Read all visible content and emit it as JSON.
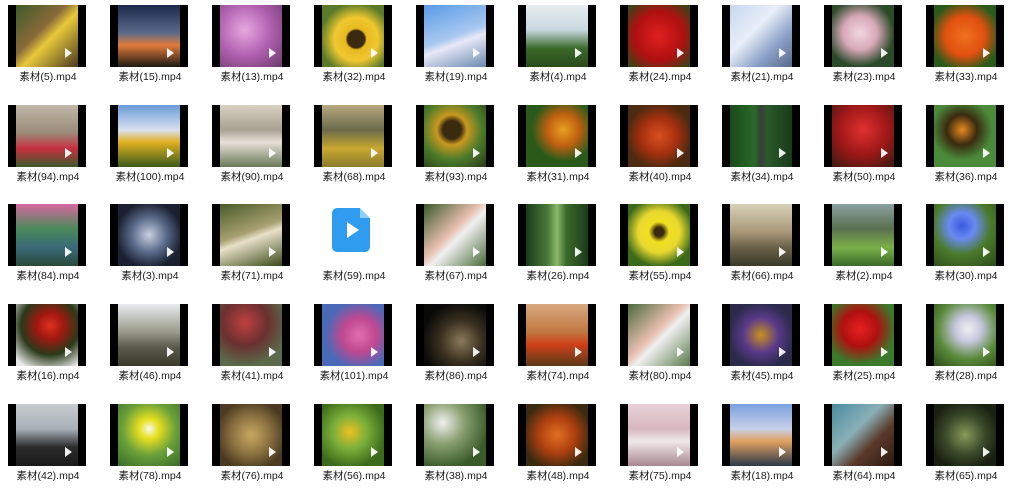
{
  "files": [
    {
      "name": "素材(5).mp4",
      "bg": "linear-gradient(135deg,#3d5a2a,#8a6a3a 40%,#e8c83a 55%,#4a3a20)"
    },
    {
      "name": "素材(15).mp4",
      "bg": "linear-gradient(180deg,#1b2a4a,#5b6a8a 45%,#e07a3a 65%,#1a1a14)"
    },
    {
      "name": "素材(13).mp4",
      "bg": "radial-gradient(circle at 40% 40%,#e8a8e0,#b060b0 50%,#6a3a6a)"
    },
    {
      "name": "素材(32).mp4",
      "bg": "radial-gradient(circle at 55% 55%,#3a2a10 18%,#e8b820 22%,#f0c830 45%,#5a7a2a 75%)"
    },
    {
      "name": "素材(19).mp4",
      "bg": "linear-gradient(160deg,#5a9ae8,#a8c8f0 50%,#e8e8f8 60%,#6a8ab0)"
    },
    {
      "name": "素材(4).mp4",
      "bg": "linear-gradient(180deg,#e8eef0,#c8d8e0 40%,#3a6a2a 70%,#2a4a1a)"
    },
    {
      "name": "素材(24).mp4",
      "bg": "radial-gradient(circle at 50% 50%,#e02020,#b01010 55%,#2a4a1a)"
    },
    {
      "name": "素材(21).mp4",
      "bg": "linear-gradient(135deg,#c8d8f0,#e8eef8 40%,#8aa0c8 70%,#5a6a8a)"
    },
    {
      "name": "素材(23).mp4",
      "bg": "radial-gradient(circle at 45% 45%,#f0d8e0,#d8a8b8 35%,#2a4a2a 70%)"
    },
    {
      "name": "素材(33).mp4",
      "bg": "radial-gradient(circle at 50% 50%,#f07020,#e05010 45%,#2a5a1a 80%)"
    },
    {
      "name": "素材(94).mp4",
      "bg": "linear-gradient(180deg,#c0b8a8,#9a8a78 45%,#c83040 70%,#3a5a2a)"
    },
    {
      "name": "素材(100).mp4",
      "bg": "linear-gradient(180deg,#6a9ad8,#d8e0f0 40%,#e0b020 60%,#3a5a1a)"
    },
    {
      "name": "素材(90).mp4",
      "bg": "linear-gradient(180deg,#d8d0c0,#a8a090 40%,#e8e0d8 60%,#6a7a5a)"
    },
    {
      "name": "素材(68).mp4",
      "bg": "linear-gradient(180deg,#b8a880,#6a6a4a 40%,#c8a830 70%,#8a7a2a)"
    },
    {
      "name": "素材(93).mp4",
      "bg": "radial-gradient(circle at 45% 40%,#3a2a10 18%,#c89820 30%,#4a7a2a 60%,#2a3a1a)"
    },
    {
      "name": "素材(31).mp4",
      "bg": "radial-gradient(circle at 60% 40%,#e8a020,#c06010 30%,#2a5a1a 60%)"
    },
    {
      "name": "素材(40).mp4",
      "bg": "radial-gradient(circle at 50% 50%,#d85020,#a83010 40%,#4a2a10 75%)"
    },
    {
      "name": "素材(34).mp4",
      "bg": "linear-gradient(90deg,#1a4a1a,#2a6a2a 40%,#3a3a3a 50%,#2a5a2a 60%,#1a3a1a)"
    },
    {
      "name": "素材(50).mp4",
      "bg": "radial-gradient(circle at 50% 40%,#e03030,#a01818 50%,#3a1a10)"
    },
    {
      "name": "素材(36).mp4",
      "bg": "radial-gradient(circle at 45% 40%,#e88a20,#3a2a10 30%,#4a8a3a 60%)"
    },
    {
      "name": "素材(84).mp4",
      "bg": "linear-gradient(180deg,#d868a0,#4a8a5a 40%,#3a6a7a 70%,#2a4a3a)"
    },
    {
      "name": "素材(3).mp4",
      "bg": "radial-gradient(circle at 50% 50%,#c8d0e0,#5a6a8a 40%,#1a2030 75%)"
    },
    {
      "name": "素材(71).mp4",
      "bg": "linear-gradient(160deg,#4a5a2a,#a8a070 45%,#e8e0c8 55%,#3a4a1a)"
    },
    {
      "name": "素材(59).mp4",
      "bg": ""
    },
    {
      "name": "素材(67).mp4",
      "bg": "linear-gradient(135deg,#3a5a2a,#e8c0b0 45%,#f0f0f0 55%,#4a6a3a)"
    },
    {
      "name": "素材(26).mp4",
      "bg": "linear-gradient(90deg,#1a3a1a,#4a7a3a 35%,#8ab86a 50%,#3a6a2a 65%,#1a3a1a)"
    },
    {
      "name": "素材(55).mp4",
      "bg": "radial-gradient(circle at 50% 45%,#3a2a10 10%,#f0e020 22%,#e8d830 45%,#3a6a1a 75%)"
    },
    {
      "name": "素材(66).mp4",
      "bg": "linear-gradient(180deg,#d8d0b8,#a89878 45%,#6a6048 70%,#3a3a2a)"
    },
    {
      "name": "素材(2).mp4",
      "bg": "linear-gradient(180deg,#8aa0a0,#5a7050 40%,#7ab048 70%,#3a6a2a)"
    },
    {
      "name": "素材(30).mp4",
      "bg": "radial-gradient(circle at 45% 35%,#3a5ae0,#6a8af0 25%,#4a7a2a 55%,#2a4a1a)"
    },
    {
      "name": "素材(16).mp4",
      "bg": "radial-gradient(circle at 55% 35%,#e03020,#a01810 25%,#2a3a1a 55%,#e8e8e8 90%)"
    },
    {
      "name": "素材(46).mp4",
      "bg": "linear-gradient(180deg,#e8ecf0,#9a9a8a 45%,#5a5a4a 70%,#3a3a2a)"
    },
    {
      "name": "素材(41).mp4",
      "bg": "radial-gradient(circle at 40% 30%,#c04040,#6a3030 40%,#5a6a4a 75%)"
    },
    {
      "name": "素材(101).mp4",
      "bg": "radial-gradient(circle at 60% 50%,#e070b0,#c04890 35%,#4a6ab8 70%)"
    },
    {
      "name": "素材(86).mp4",
      "bg": "radial-gradient(circle at 60% 60%,#8a7a5a,#3a3020 40%,#0a0a08 75%)"
    },
    {
      "name": "素材(74).mp4",
      "bg": "linear-gradient(180deg,#d8a880,#c07840 45%,#d04018 65%,#5a3a1a)"
    },
    {
      "name": "素材(80).mp4",
      "bg": "linear-gradient(135deg,#4a6a3a,#e8c0b0 45%,#f0f0f0 55%,#5a7a4a)"
    },
    {
      "name": "素材(45).mp4",
      "bg": "radial-gradient(circle at 50% 50%,#c89020,#5a3a8a 40%,#2a2a4a 75%)"
    },
    {
      "name": "素材(25).mp4",
      "bg": "radial-gradient(circle at 45% 40%,#e82020,#b01010 35%,#3a7a2a 70%)"
    },
    {
      "name": "素材(28).mp4",
      "bg": "radial-gradient(circle at 55% 40%,#f0f0f0,#c8c8e0 25%,#5a8a3a 60%,#2a4a1a)"
    },
    {
      "name": "素材(42).mp4",
      "bg": "linear-gradient(180deg,#c8ccd0,#a8b0b8 40%,#2a2a2a 70%,#1a1a1a)"
    },
    {
      "name": "素材(78).mp4",
      "bg": "radial-gradient(circle at 50% 40%,#f8f8f0,#e8e020 20%,#6aa03a 55%,#3a6a2a)"
    },
    {
      "name": "素材(76).mp4",
      "bg": "radial-gradient(circle at 50% 50%,#c8a860,#8a7040 45%,#4a3a20 80%)"
    },
    {
      "name": "素材(56).mp4",
      "bg": "radial-gradient(circle at 45% 45%,#f0c020,#7ab03a 35%,#3a6a1a 75%)"
    },
    {
      "name": "素材(38).mp4",
      "bg": "radial-gradient(circle at 30% 30%,#f0f0f0,#8aa070 35%,#3a5a2a 75%)"
    },
    {
      "name": "素材(48).mp4",
      "bg": "radial-gradient(circle at 50% 50%,#e07020,#b04010 40%,#3a2a10 80%)"
    },
    {
      "name": "素材(75).mp4",
      "bg": "linear-gradient(180deg,#e8d0d8,#d8b8c0 40%,#f0e8e8 60%,#a88890)"
    },
    {
      "name": "素材(18).mp4",
      "bg": "linear-gradient(180deg,#7aa0e0,#c8d0e8 40%,#e0a060 60%,#2a3a4a)"
    },
    {
      "name": "素材(64).mp4",
      "bg": "linear-gradient(135deg,#4a8aa0,#8ab0b8 40%,#5a3a2a 65%,#2a1a10)"
    },
    {
      "name": "素材(65).mp4",
      "bg": "radial-gradient(circle at 50% 50%,#8a9a5a,#3a4a2a 45%,#1a2010 80%)"
    }
  ]
}
